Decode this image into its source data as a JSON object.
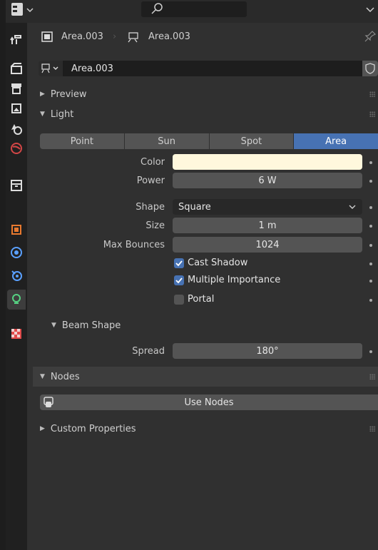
{
  "breadcrumb": {
    "object_name": "Area.003",
    "data_name": "Area.003"
  },
  "datablock": {
    "name": "Area.003"
  },
  "panels": {
    "preview": "Preview",
    "light": "Light",
    "beam_shape": "Beam Shape",
    "nodes": "Nodes",
    "custom_properties": "Custom Properties"
  },
  "light_types": [
    "Point",
    "Sun",
    "Spot",
    "Area"
  ],
  "light_type_selected": "Area",
  "props": {
    "color_label": "Color",
    "color_value": "#fff8dd",
    "power_label": "Power",
    "power_value": "6 W",
    "shape_label": "Shape",
    "shape_value": "Square",
    "size_label": "Size",
    "size_value": "1 m",
    "bounces_label": "Max Bounces",
    "bounces_value": "1024",
    "cast_shadow_label": "Cast Shadow",
    "cast_shadow_checked": true,
    "multiple_importance_label": "Multiple Importance",
    "multiple_importance_checked": true,
    "portal_label": "Portal",
    "portal_checked": false,
    "spread_label": "Spread",
    "spread_value": "180°"
  },
  "nodes": {
    "use_nodes_label": "Use Nodes"
  },
  "colors": {
    "accent": "#4772b3",
    "active_tab_icon": "#56d282",
    "object_icon": "#e8792f",
    "world_icon": "#d24646",
    "constraint_icon": "#5aa0ff"
  },
  "sidebar_tabs": [
    "tool-icon",
    "render-icon",
    "output-icon",
    "view-layer-icon",
    "scene-icon",
    "world-icon",
    "collection-icon",
    "object-icon",
    "modifier-icon",
    "physics-icon",
    "light-data-icon",
    "texture-icon"
  ]
}
